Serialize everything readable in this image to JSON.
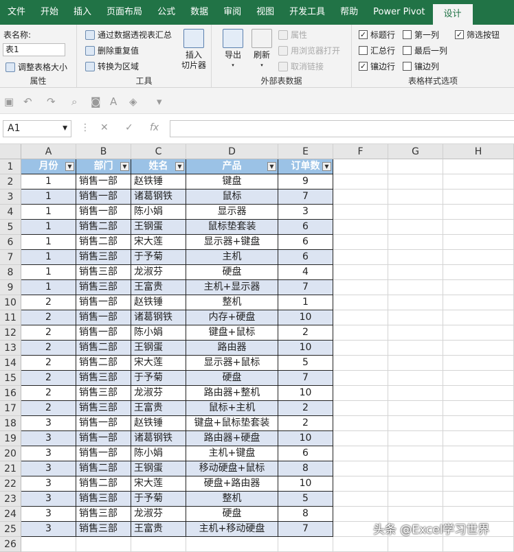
{
  "tabs": [
    "文件",
    "开始",
    "插入",
    "页面布局",
    "公式",
    "数据",
    "审阅",
    "视图",
    "开发工具",
    "帮助",
    "Power Pivot",
    "设计"
  ],
  "ribbon": {
    "props": {
      "table_name_label": "表名称:",
      "table_name_value": "表1",
      "resize_label": "调整表格大小",
      "group": "属性"
    },
    "tools": {
      "pivot": "通过数据透视表汇总",
      "remove_dup": "删除重复值",
      "convert": "转换为区域",
      "slicer": "插入\n切片器",
      "group": "工具"
    },
    "external": {
      "export": "导出",
      "refresh": "刷新",
      "properties": "属性",
      "open_browser": "用浏览器打开",
      "unlink": "取消链接",
      "group": "外部表数据"
    },
    "style_options": {
      "header_row": "标题行",
      "total_row": "汇总行",
      "banded_rows": "镶边行",
      "first_col": "第一列",
      "last_col": "最后一列",
      "banded_cols": "镶边列",
      "filter_btn": "筛选按钮",
      "group": "表格样式选项",
      "checked": {
        "header_row": true,
        "total_row": false,
        "banded_rows": true,
        "first_col": false,
        "last_col": false,
        "banded_cols": false,
        "filter_btn": true
      }
    }
  },
  "formula_bar": {
    "cell_ref": "A1",
    "fx": "fx",
    "value": ""
  },
  "columns": [
    "A",
    "B",
    "C",
    "D",
    "E",
    "F",
    "G",
    "H"
  ],
  "table": {
    "headers": [
      "月份",
      "部门",
      "姓名",
      "产品",
      "订单数"
    ],
    "rows": [
      [
        "1",
        "销售一部",
        "赵铁锤",
        "键盘",
        "9"
      ],
      [
        "1",
        "销售一部",
        "诸葛钢铁",
        "鼠标",
        "7"
      ],
      [
        "1",
        "销售一部",
        "陈小娟",
        "显示器",
        "3"
      ],
      [
        "1",
        "销售二部",
        "王钢蛋",
        "鼠标垫套装",
        "6"
      ],
      [
        "1",
        "销售二部",
        "宋大莲",
        "显示器+键盘",
        "6"
      ],
      [
        "1",
        "销售三部",
        "于予菊",
        "主机",
        "6"
      ],
      [
        "1",
        "销售三部",
        "龙淑芬",
        "硬盘",
        "4"
      ],
      [
        "1",
        "销售三部",
        "王富贵",
        "主机+显示器",
        "7"
      ],
      [
        "2",
        "销售一部",
        "赵铁锤",
        "整机",
        "1"
      ],
      [
        "2",
        "销售一部",
        "诸葛钢铁",
        "内存+硬盘",
        "10"
      ],
      [
        "2",
        "销售一部",
        "陈小娟",
        "键盘+鼠标",
        "2"
      ],
      [
        "2",
        "销售二部",
        "王钢蛋",
        "路由器",
        "10"
      ],
      [
        "2",
        "销售二部",
        "宋大莲",
        "显示器+鼠标",
        "5"
      ],
      [
        "2",
        "销售三部",
        "于予菊",
        "硬盘",
        "7"
      ],
      [
        "2",
        "销售三部",
        "龙淑芬",
        "路由器+整机",
        "10"
      ],
      [
        "2",
        "销售三部",
        "王富贵",
        "鼠标+主机",
        "2"
      ],
      [
        "3",
        "销售一部",
        "赵铁锤",
        "键盘+鼠标垫套装",
        "2"
      ],
      [
        "3",
        "销售一部",
        "诸葛钢铁",
        "路由器+硬盘",
        "10"
      ],
      [
        "3",
        "销售一部",
        "陈小娟",
        "主机+键盘",
        "6"
      ],
      [
        "3",
        "销售二部",
        "王钢蛋",
        "移动硬盘+鼠标",
        "8"
      ],
      [
        "3",
        "销售二部",
        "宋大莲",
        "硬盘+路由器",
        "10"
      ],
      [
        "3",
        "销售三部",
        "于予菊",
        "整机",
        "5"
      ],
      [
        "3",
        "销售三部",
        "龙淑芬",
        "硬盘",
        "8"
      ],
      [
        "3",
        "销售三部",
        "王富贵",
        "主机+移动硬盘",
        "7"
      ]
    ]
  },
  "row_numbers": [
    "1",
    "2",
    "3",
    "4",
    "5",
    "6",
    "7",
    "8",
    "9",
    "10",
    "11",
    "12",
    "13",
    "14",
    "15",
    "16",
    "17",
    "18",
    "19",
    "20",
    "21",
    "22",
    "23",
    "24",
    "25",
    "26"
  ],
  "watermark": "头条 @Excel学习世界"
}
